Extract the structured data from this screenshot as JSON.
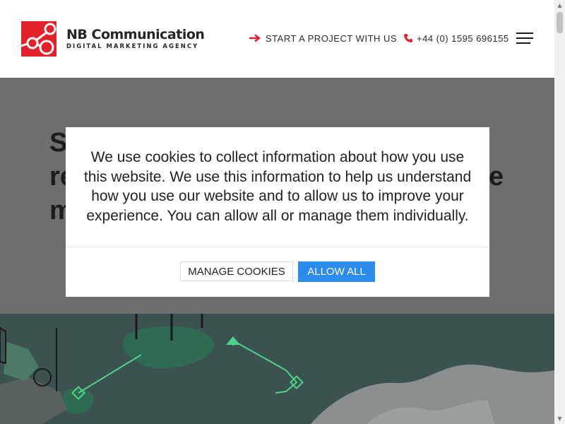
{
  "header": {
    "brand_name": "NB Communication",
    "brand_tagline": "DIGITAL MARKETING AGENCY",
    "cta_label": "START A PROJECT WITH US",
    "phone": "+44 (0) 1595 696155",
    "accent_color": "#e3212b"
  },
  "hero": {
    "heading_lines": [
      "St",
      "re",
      "m"
    ],
    "heading_suffix": "e",
    "background_color": "#6e6e6e"
  },
  "cookie_modal": {
    "message": "We use cookies to collect information about how you use this website. We use this information to help us understand how you use our website and to allow us to improve your experience. You can allow all or manage them individually.",
    "manage_label": "MANAGE COOKIES",
    "allow_label": "ALLOW ALL",
    "allow_color": "#2b8ced"
  },
  "icons": {
    "cta": "arrow-right-icon",
    "phone": "phone-icon",
    "menu": "hamburger-menu-icon"
  }
}
